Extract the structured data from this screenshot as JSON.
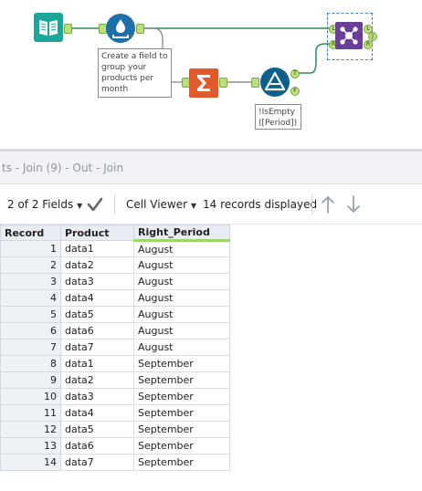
{
  "canvas": {
    "annotation_formula": "Create a field to group your products per month",
    "annotation_filter": "!IsEmpty ([Period])",
    "filter_true_label": "T",
    "filter_false_label": "F",
    "join_left_label": "L",
    "join_right_label": "R",
    "join_j_label": "J",
    "join_out_label": "J",
    "tools": [
      "book-icon",
      "formula-icon",
      "summarize-icon",
      "filter-icon",
      "join-icon"
    ],
    "colors": {
      "book": "#1aa79a",
      "formula": "#1f6fa8",
      "summarize": "#e2592b",
      "filter": "#0d5f8c",
      "join": "#6a3f9a",
      "wire": "#2e8b57"
    }
  },
  "results": {
    "title": "ts - Join (9) - Out - Join",
    "fields_label": "2 of 2 Fields",
    "cell_viewer_label": "Cell Viewer",
    "records_label": "14 records displayed"
  },
  "grid": {
    "headers": [
      "Record",
      "Product",
      "Right_Period"
    ],
    "rows": [
      [
        "1",
        "data1",
        "August"
      ],
      [
        "2",
        "data2",
        "August"
      ],
      [
        "3",
        "data3",
        "August"
      ],
      [
        "4",
        "data4",
        "August"
      ],
      [
        "5",
        "data5",
        "August"
      ],
      [
        "6",
        "data6",
        "August"
      ],
      [
        "7",
        "data7",
        "August"
      ],
      [
        "8",
        "data1",
        "September"
      ],
      [
        "9",
        "data2",
        "September"
      ],
      [
        "10",
        "data3",
        "September"
      ],
      [
        "11",
        "data4",
        "September"
      ],
      [
        "12",
        "data5",
        "September"
      ],
      [
        "13",
        "data6",
        "September"
      ],
      [
        "14",
        "data7",
        "September"
      ]
    ]
  }
}
